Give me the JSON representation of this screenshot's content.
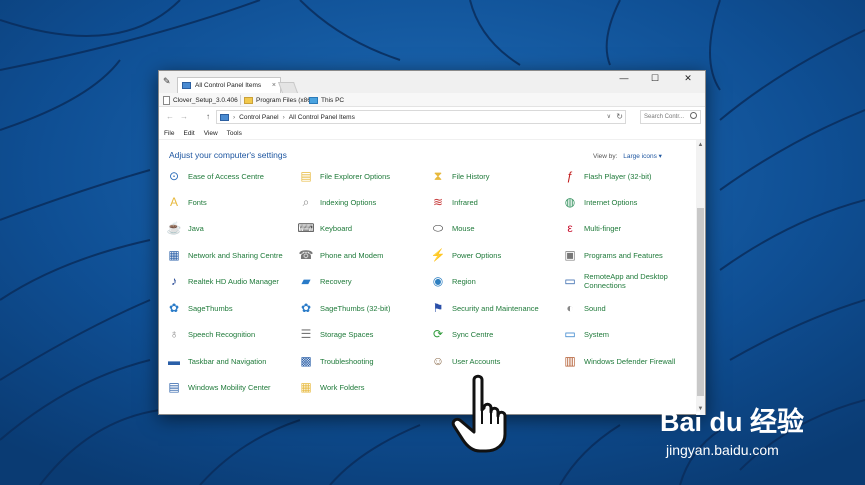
{
  "window": {
    "tab_title": "All Control Panel Items",
    "tab_close": "×",
    "controls": {
      "minimize": "—",
      "maximize": "☐",
      "close": "✕"
    }
  },
  "favorites": [
    {
      "label": "Clover_Setup_3.0.406",
      "icon": "file-icon"
    },
    {
      "label": "Program Files (x86)",
      "icon": "folder-icon"
    },
    {
      "label": "This PC",
      "icon": "computer-icon"
    }
  ],
  "address": {
    "back": "←",
    "forward": "→",
    "up": "↑",
    "crumbs": [
      "Control Panel",
      "All Control Panel Items"
    ],
    "separator": "›",
    "dropdown": "∨",
    "refresh": "↻",
    "search_placeholder": "Search Contr..."
  },
  "menu": [
    "File",
    "Edit",
    "View",
    "Tools"
  ],
  "content": {
    "heading": "Adjust your computer's settings",
    "view_by_label": "View by:",
    "view_by_value": "Large icons ▾"
  },
  "items": [
    {
      "label": "Ease of Access Centre",
      "icon": "ease-of-access-icon",
      "glyph": "⊙",
      "color": "#2a6bb8"
    },
    {
      "label": "File Explorer Options",
      "icon": "folder-options-icon",
      "glyph": "▤",
      "color": "#e7b93d"
    },
    {
      "label": "File History",
      "icon": "file-history-icon",
      "glyph": "⧗",
      "color": "#e7b93d"
    },
    {
      "label": "Flash Player (32-bit)",
      "icon": "flash-player-icon",
      "glyph": "ƒ",
      "color": "#c01818"
    },
    {
      "label": "Fonts",
      "icon": "fonts-icon",
      "glyph": "A",
      "color": "#e7b93d"
    },
    {
      "label": "Indexing Options",
      "icon": "indexing-icon",
      "glyph": "⌕",
      "color": "#8a8a8a"
    },
    {
      "label": "Infrared",
      "icon": "infrared-icon",
      "glyph": "≋",
      "color": "#c73a3a"
    },
    {
      "label": "Internet Options",
      "icon": "internet-options-icon",
      "glyph": "◍",
      "color": "#2e8f5a"
    },
    {
      "label": "Java",
      "icon": "java-icon",
      "glyph": "☕",
      "color": "#c05a1a"
    },
    {
      "label": "Keyboard",
      "icon": "keyboard-icon",
      "glyph": "⌨",
      "color": "#555555"
    },
    {
      "label": "Mouse",
      "icon": "mouse-icon",
      "glyph": "⬭",
      "color": "#333333"
    },
    {
      "label": "Multi-finger",
      "icon": "multi-finger-icon",
      "glyph": "ε",
      "color": "#c8102e"
    },
    {
      "label": "Network and Sharing Centre",
      "icon": "network-icon",
      "glyph": "▦",
      "color": "#2a5fa8"
    },
    {
      "label": "Phone and Modem",
      "icon": "phone-modem-icon",
      "glyph": "☎",
      "color": "#777777"
    },
    {
      "label": "Power Options",
      "icon": "power-options-icon",
      "glyph": "⚡",
      "color": "#2e8f3a"
    },
    {
      "label": "Programs and Features",
      "icon": "programs-icon",
      "glyph": "▣",
      "color": "#777777"
    },
    {
      "label": "Realtek HD Audio Manager",
      "icon": "realtek-audio-icon",
      "glyph": "♪",
      "color": "#1a3f8f"
    },
    {
      "label": "Recovery",
      "icon": "recovery-icon",
      "glyph": "▰",
      "color": "#2a7bc8"
    },
    {
      "label": "Region",
      "icon": "region-icon",
      "glyph": "◉",
      "color": "#2e7fc0"
    },
    {
      "label": "RemoteApp and Desktop Connections",
      "icon": "remoteapp-icon",
      "glyph": "▭",
      "color": "#2a5fa8"
    },
    {
      "label": "SageThumbs",
      "icon": "sagethumbs-icon",
      "glyph": "✿",
      "color": "#2a7bc8"
    },
    {
      "label": "SageThumbs (32-bit)",
      "icon": "sagethumbs-32-icon",
      "glyph": "✿",
      "color": "#2a7bc8"
    },
    {
      "label": "Security and Maintenance",
      "icon": "security-flag-icon",
      "glyph": "⚑",
      "color": "#2a4fa8"
    },
    {
      "label": "Sound",
      "icon": "sound-icon",
      "glyph": "◐",
      "color": "#888888"
    },
    {
      "label": "Speech Recognition",
      "icon": "microphone-icon",
      "glyph": "♁",
      "color": "#888888"
    },
    {
      "label": "Storage Spaces",
      "icon": "storage-spaces-icon",
      "glyph": "☰",
      "color": "#777777"
    },
    {
      "label": "Sync Centre",
      "icon": "sync-centre-icon",
      "glyph": "⟳",
      "color": "#2e9a3a"
    },
    {
      "label": "System",
      "icon": "system-icon",
      "glyph": "▭",
      "color": "#2a7bc8"
    },
    {
      "label": "Taskbar and Navigation",
      "icon": "taskbar-icon",
      "glyph": "▬",
      "color": "#2a5fa8"
    },
    {
      "label": "Troubleshooting",
      "icon": "troubleshooting-icon",
      "glyph": "▩",
      "color": "#2a5fa8"
    },
    {
      "label": "User Accounts",
      "icon": "user-accounts-icon",
      "glyph": "☺",
      "color": "#8a6a4a"
    },
    {
      "label": "Windows Defender Firewall",
      "icon": "firewall-icon",
      "glyph": "▥",
      "color": "#b0562a"
    },
    {
      "label": "Windows Mobility Center",
      "icon": "mobility-center-icon",
      "glyph": "▤",
      "color": "#2a5fa8"
    },
    {
      "label": "Work Folders",
      "icon": "work-folders-icon",
      "glyph": "▦",
      "color": "#e7b93d"
    }
  ],
  "scrollbar": {
    "up": "▲",
    "down": "▼"
  },
  "watermark": {
    "logo": "Bai du 经验",
    "url": "jingyan.baidu.com"
  }
}
